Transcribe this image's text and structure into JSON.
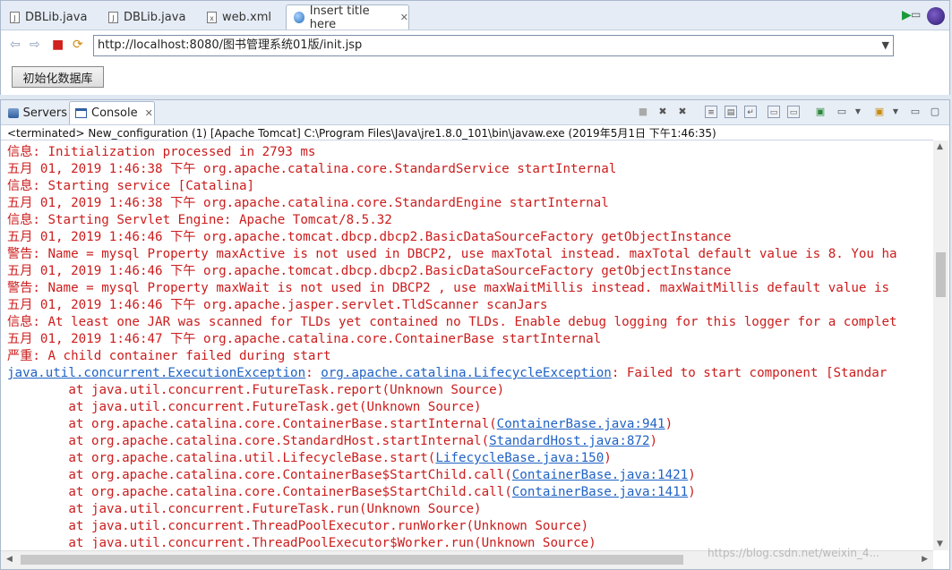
{
  "editor_tabs": [
    {
      "label": "DBLib.java",
      "icon": "java-file-icon"
    },
    {
      "label": "DBLib.java",
      "icon": "java-file-icon"
    },
    {
      "label": "web.xml",
      "icon": "xml-file-icon"
    },
    {
      "label": "Insert title here",
      "icon": "globe-icon",
      "close": "✕"
    }
  ],
  "browser": {
    "url": "http://localhost:8080/图书管理系统01版/init.jsp",
    "init_button": "初始化数据库"
  },
  "console": {
    "tabs": [
      {
        "label": "Servers"
      },
      {
        "label": "Console",
        "close": "✕"
      }
    ],
    "status": "<terminated> New_configuration (1) [Apache Tomcat] C:\\Program Files\\Java\\jre1.8.0_101\\bin\\javaw.exe (2019年5月1日 下午1:46:35)",
    "lines": [
      "信息: Initialization processed in 2793 ms",
      "五月 01, 2019 1:46:38 下午 org.apache.catalina.core.StandardService startInternal",
      "信息: Starting service [Catalina]",
      "五月 01, 2019 1:46:38 下午 org.apache.catalina.core.StandardEngine startInternal",
      "信息: Starting Servlet Engine: Apache Tomcat/8.5.32",
      "五月 01, 2019 1:46:46 下午 org.apache.tomcat.dbcp.dbcp2.BasicDataSourceFactory getObjectInstance",
      "警告: Name = mysql Property maxActive is not used in DBCP2, use maxTotal instead. maxTotal default value is 8. You ha",
      "五月 01, 2019 1:46:46 下午 org.apache.tomcat.dbcp.dbcp2.BasicDataSourceFactory getObjectInstance",
      "警告: Name = mysql Property maxWait is not used in DBCP2 , use maxWaitMillis instead. maxWaitMillis default value is",
      "五月 01, 2019 1:46:46 下午 org.apache.jasper.servlet.TldScanner scanJars",
      "信息: At least one JAR was scanned for TLDs yet contained no TLDs. Enable debug logging for this logger for a complet",
      "五月 01, 2019 1:46:47 下午 org.apache.catalina.core.ContainerBase startInternal",
      "严重: A child container failed during start"
    ],
    "exception": {
      "type": "java.util.concurrent.ExecutionException",
      "sep1": ": ",
      "cause": "org.apache.catalina.LifecycleException",
      "rest": ": Failed to start component [Standar"
    },
    "trace": [
      {
        "text": "        at java.util.concurrent.FutureTask.report(Unknown Source)"
      },
      {
        "text": "        at java.util.concurrent.FutureTask.get(Unknown Source)"
      },
      {
        "text": "        at org.apache.catalina.core.ContainerBase.startInternal(",
        "link": "ContainerBase.java:941",
        "tail": ")"
      },
      {
        "text": "        at org.apache.catalina.core.StandardHost.startInternal(",
        "link": "StandardHost.java:872",
        "tail": ")"
      },
      {
        "text": "        at org.apache.catalina.util.LifecycleBase.start(",
        "link": "LifecycleBase.java:150",
        "tail": ")"
      },
      {
        "text": "        at org.apache.catalina.core.ContainerBase$StartChild.call(",
        "link": "ContainerBase.java:1421",
        "tail": ")"
      },
      {
        "text": "        at org.apache.catalina.core.ContainerBase$StartChild.call(",
        "link": "ContainerBase.java:1411",
        "tail": ")"
      },
      {
        "text": "        at java.util.concurrent.FutureTask.run(Unknown Source)"
      },
      {
        "text": "        at java.util.concurrent.ThreadPoolExecutor.runWorker(Unknown Source)"
      },
      {
        "text": "        at java.util.concurrent.ThreadPoolExecutor$Worker.run(Unknown Source)"
      }
    ]
  },
  "colors": {
    "log_red": "#cc1c1c",
    "link_blue": "#1f62c4"
  }
}
